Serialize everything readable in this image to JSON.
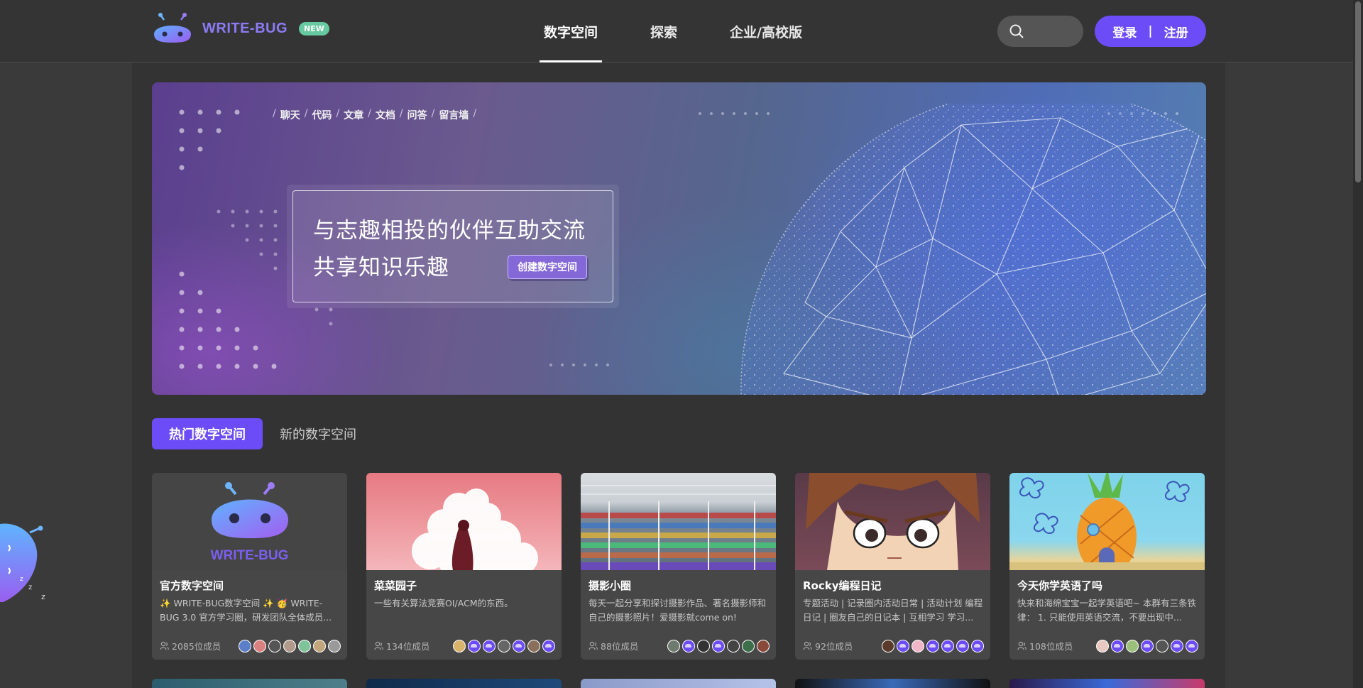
{
  "brand": {
    "name": "WRITE-BUG",
    "badge": "NEW"
  },
  "nav": {
    "items": [
      {
        "label": "数字空间",
        "active": true
      },
      {
        "label": "探索",
        "active": false
      },
      {
        "label": "企业/高校版",
        "active": false
      }
    ],
    "search_icon": "search-icon",
    "login_label": "登录",
    "divider": "|",
    "register_label": "注册"
  },
  "banner": {
    "tags": [
      "聊天",
      "代码",
      "文章",
      "文档",
      "问答",
      "留言墙"
    ],
    "line1": "与志趣相投的伙伴互助交流",
    "line2": "共享知识乐趣",
    "cta_label": "创建数字空间"
  },
  "tabs": [
    {
      "label": "热门数字空间",
      "active": true
    },
    {
      "label": "新的数字空间",
      "active": false
    }
  ],
  "cards": [
    {
      "title": "官方数字空间",
      "desc": "✨ WRITE-BUG数字空间 ✨ 🥳 WRITE-BUG 3.0 官方学习圈，研发团队全体成员...",
      "members": "2085位成员",
      "cover_text": "WRITE-BUG",
      "avatars": [
        "img",
        "img",
        "img",
        "img",
        "img",
        "img",
        "img"
      ]
    },
    {
      "title": "菜菜园子",
      "desc": "一些有关算法竞赛OI/ACM的东西。",
      "members": "134位成员",
      "avatars": [
        "img",
        "purple",
        "purple",
        "img",
        "purple",
        "img",
        "purple"
      ]
    },
    {
      "title": "摄影小圈",
      "desc": "每天一起分享和探讨摄影作品、著名摄影师和自己的摄影照片！爱摄影就come on!",
      "members": "88位成员",
      "avatars": [
        "img",
        "purple",
        "img",
        "purple",
        "img",
        "img",
        "img"
      ]
    },
    {
      "title": "Rocky编程日记",
      "desc": "专题活动 | 记录圈内活动日常 | 活动计划 编程日记 | 圈友自己的日记本 | 互相学习 学习...",
      "members": "92位成员",
      "avatars": [
        "img",
        "purple",
        "img",
        "purple",
        "purple",
        "purple",
        "purple"
      ]
    },
    {
      "title": "今天你学英语了吗",
      "desc": "快来和海绵宝宝一起学英语吧~ 本群有三条铁律：  1. 只能使用英语交流，不要出现中...",
      "members": "108位成员",
      "avatars": [
        "img",
        "purple",
        "img",
        "purple",
        "img",
        "purple",
        "purple"
      ]
    }
  ],
  "colors": {
    "accent": "#6b4cf6",
    "badge": "#67c9a0",
    "panel": "#333333",
    "card": "#474747"
  }
}
